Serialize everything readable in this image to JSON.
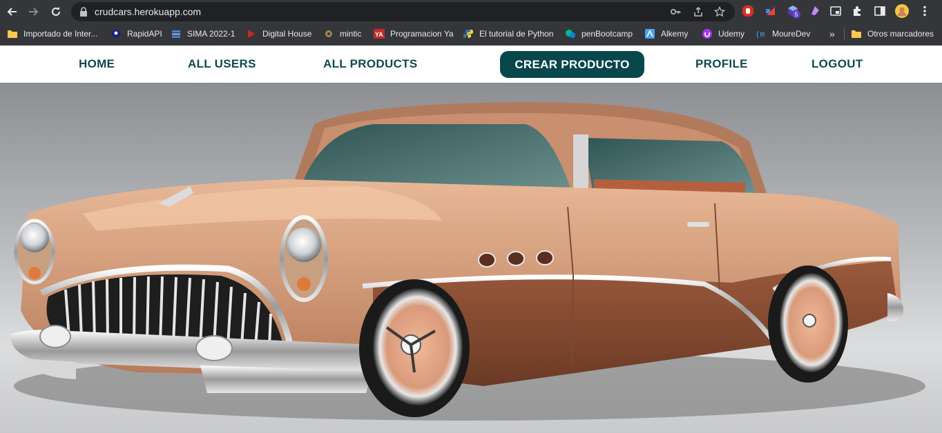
{
  "browser": {
    "url": "crudcars.herokuapp.com",
    "bookmarks": [
      {
        "label": "Importado de Inter...",
        "icon": "folder-icon"
      },
      {
        "label": "RapidAPI",
        "icon": "rapidapi-icon"
      },
      {
        "label": "SIMA 2022-1",
        "icon": "sima-icon"
      },
      {
        "label": "Digital House",
        "icon": "digital-house-icon"
      },
      {
        "label": "mintic",
        "icon": "mintic-icon"
      },
      {
        "label": "Programacion Ya",
        "icon": "programacion-ya-icon"
      },
      {
        "label": "El tutorial de Python",
        "icon": "python-icon"
      },
      {
        "label": "penBootcamp",
        "icon": "penbootcamp-icon"
      },
      {
        "label": "Alkemy",
        "icon": "alkemy-icon"
      },
      {
        "label": "Udemy",
        "icon": "udemy-icon"
      },
      {
        "label": "MoureDev",
        "icon": "mouredev-icon"
      }
    ],
    "overflow": "»",
    "other_bookmarks": "Otros marcadores",
    "extension_badge": "5"
  },
  "nav": {
    "home": "HOME",
    "all_users": "ALL USERS",
    "all_products": "ALL PRODUCTS",
    "crear_producto": "CREAR PRODUCTO",
    "profile": "PROFILE",
    "logout": "LOGOUT"
  },
  "colors": {
    "chrome_bg": "#35363a",
    "nav_text": "#0d4a4f",
    "cta_bg": "#08474c",
    "car_body": "#d09a78",
    "car_lower": "#8a4f35"
  },
  "hero": {
    "image": "vintage-copper-car-photo"
  }
}
